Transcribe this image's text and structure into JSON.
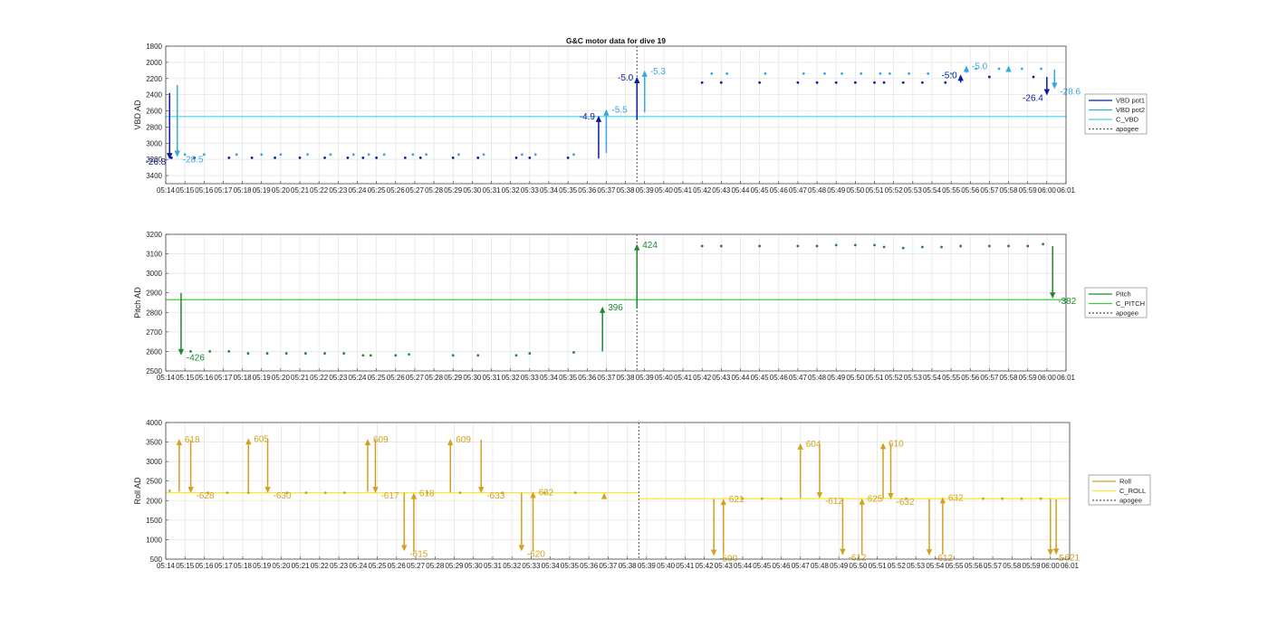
{
  "chart_data": [
    {
      "type": "scatter",
      "title": "G&C motor data for dive 19",
      "ylabel": "VBD AD",
      "ylim": [
        1800,
        3500
      ],
      "y_reversed": true,
      "yticks": [
        1800,
        2000,
        2200,
        2400,
        2600,
        2800,
        3000,
        3200,
        3400
      ],
      "xlim": [
        "05:14",
        "06:01"
      ],
      "apogee_x": "05:38.6",
      "grid": true,
      "legend_position": "outside-right",
      "legend": [
        "VBD pot1",
        "VBD pot2",
        "C_VBD",
        "apogee"
      ],
      "colors": {
        "pot1": "#0a1aa0",
        "pot2": "#3aa6e0",
        "c_line": "#3fd6e6",
        "apogee": "#555555"
      },
      "c_line": [
        {
          "x0": "05:14",
          "x1": "06:01",
          "y": 2670
        }
      ],
      "series": [
        {
          "name": "VBD pot1",
          "x": [
            "05:14.3",
            "05:15.5",
            "05:17.3",
            "05:18.5",
            "05:19.7",
            "05:21",
            "05:22.3",
            "05:23.5",
            "05:24.3",
            "05:25",
            "05:26.5",
            "05:27.3",
            "05:29",
            "05:30.3",
            "05:32.3",
            "05:33",
            "05:35",
            "05:42",
            "05:43",
            "05:45",
            "05:47",
            "05:48",
            "05:49",
            "05:50",
            "05:51",
            "05:51.5",
            "05:52.5",
            "05:53.5",
            "05:54.7",
            "05:57",
            "05:59.3"
          ],
          "y": [
            3180,
            3180,
            3180,
            3180,
            3180,
            3180,
            3180,
            3180,
            3180,
            3180,
            3180,
            3180,
            3180,
            3180,
            3180,
            3180,
            3180,
            2250,
            2250,
            2250,
            2250,
            2250,
            2250,
            2250,
            2250,
            2250,
            2250,
            2250,
            2250,
            2180,
            2180
          ]
        },
        {
          "name": "VBD pot2",
          "x": [
            "05:15",
            "05:16",
            "05:17.7",
            "05:19",
            "05:20",
            "05:21.4",
            "05:22.6",
            "05:23.8",
            "05:24.6",
            "05:25.4",
            "05:26.9",
            "05:27.6",
            "05:29.3",
            "05:30.6",
            "05:32.6",
            "05:33.3",
            "05:35.3",
            "05:42.5",
            "05:43.3",
            "05:45.3",
            "05:47.3",
            "05:48.4",
            "05:49.3",
            "05:50.3",
            "05:51.3",
            "05:51.8",
            "05:52.8",
            "05:53.8",
            "05:55",
            "05:56.3",
            "05:57.5",
            "05:58.7",
            "05:59.7"
          ],
          "y": [
            3140,
            3140,
            3140,
            3140,
            3140,
            3140,
            3140,
            3140,
            3140,
            3140,
            3140,
            3140,
            3140,
            3140,
            3140,
            3140,
            3140,
            2140,
            2140,
            2140,
            2140,
            2140,
            2140,
            2140,
            2140,
            2140,
            2140,
            2140,
            2140,
            2080,
            2080,
            2080,
            2080
          ]
        }
      ],
      "arrows": [
        {
          "x": "05:14.2",
          "y0": 2380,
          "y1": 3200,
          "label": "-26.8",
          "color": "pot1"
        },
        {
          "x": "05:14.6",
          "y0": 2280,
          "y1": 3170,
          "label": "-28.5",
          "color": "pot2"
        },
        {
          "x": "05:36.6",
          "y0": 3190,
          "y1": 2660,
          "label": "-4.9",
          "color": "pot1"
        },
        {
          "x": "05:37",
          "y0": 3120,
          "y1": 2580,
          "label": "-5.5",
          "color": "pot2"
        },
        {
          "x": "05:38.6",
          "y0": 2710,
          "y1": 2180,
          "label": "-5.0",
          "color": "pot1"
        },
        {
          "x": "05:39",
          "y0": 2620,
          "y1": 2100,
          "label": "-5.3",
          "color": "pot2"
        },
        {
          "x": "05:55.5",
          "y0": 2250,
          "y1": 2150,
          "label": "-5.0",
          "color": "pot1"
        },
        {
          "x": "05:55.8",
          "y0": 2130,
          "y1": 2040,
          "label": "-5.0",
          "color": "pot2"
        },
        {
          "x": "05:58",
          "y0": 2080,
          "y1": 2040,
          "label": "",
          "color": "pot2"
        },
        {
          "x": "06:00",
          "y0": 2180,
          "y1": 2410,
          "label": "-26.4",
          "color": "pot1"
        },
        {
          "x": "06:00.4",
          "y0": 2090,
          "y1": 2330,
          "label": "-28.6",
          "color": "pot2"
        }
      ]
    },
    {
      "type": "scatter",
      "ylabel": "Pitch AD",
      "ylim": [
        2500,
        3200
      ],
      "yticks": [
        2500,
        2600,
        2700,
        2800,
        2900,
        3000,
        3100,
        3200
      ],
      "xlim": [
        "05:14",
        "06:01"
      ],
      "apogee_x": "05:38.6",
      "grid": true,
      "legend_position": "outside-right",
      "legend": [
        "Pitch",
        "C_PITCH",
        "apogee"
      ],
      "colors": {
        "main": "#1f8a2e",
        "c_line": "#3ecb3e",
        "apogee": "#555555"
      },
      "c_line": [
        {
          "x0": "05:14",
          "x1": "06:01",
          "y": 2865
        }
      ],
      "series": [
        {
          "name": "Pitch",
          "x": [
            "05:15.3",
            "05:16.3",
            "05:17.3",
            "05:18.3",
            "05:19.3",
            "05:20.3",
            "05:21.3",
            "05:22.3",
            "05:23.3",
            "05:24.3",
            "05:24.7",
            "05:26",
            "05:26.7",
            "05:29",
            "05:30.3",
            "05:32.3",
            "05:33",
            "05:35.3",
            "05:42",
            "05:43",
            "05:45",
            "05:47",
            "05:48",
            "05:49",
            "05:50",
            "05:51",
            "05:51.5",
            "05:52.5",
            "05:53.5",
            "05:54.5",
            "05:55.5",
            "05:57",
            "05:58",
            "05:59",
            "05:59.8"
          ],
          "y": [
            2600,
            2600,
            2600,
            2590,
            2590,
            2590,
            2590,
            2590,
            2590,
            2580,
            2580,
            2580,
            2585,
            2580,
            2580,
            2580,
            2590,
            2595,
            3140,
            3140,
            3140,
            3140,
            3140,
            3145,
            3145,
            3145,
            3135,
            3130,
            3135,
            3135,
            3140,
            3140,
            3140,
            3140,
            3150
          ]
        }
      ],
      "arrows": [
        {
          "x": "05:14.8",
          "y0": 2900,
          "y1": 2580,
          "label": "-426"
        },
        {
          "x": "05:36.8",
          "y0": 2600,
          "y1": 2830,
          "label": "396"
        },
        {
          "x": "05:38.6",
          "y0": 2820,
          "y1": 3150,
          "label": "424"
        },
        {
          "x": "06:00.3",
          "y0": 3140,
          "y1": 2870,
          "label": "-382"
        }
      ]
    },
    {
      "type": "scatter",
      "ylabel": "Roll AD",
      "ylim": [
        500,
        4000
      ],
      "yticks": [
        500,
        1000,
        1500,
        2000,
        2500,
        3000,
        3500,
        4000
      ],
      "xlim": [
        "05:14",
        "06:01"
      ],
      "apogee_x": "05:38.6",
      "grid": true,
      "legend_position": "outside-right",
      "legend": [
        "Roll",
        "C_ROLL",
        "apogee"
      ],
      "colors": {
        "main": "#d4a020",
        "c_line": "#f2ea3a",
        "apogee": "#555555"
      },
      "c_line": [
        {
          "x0": "05:14",
          "x1": "05:38.6",
          "y": 2200
        },
        {
          "x0": "05:38.6",
          "x1": "06:01",
          "y": 2050
        }
      ],
      "series": [
        {
          "name": "Roll",
          "x": [
            "05:14.2",
            "05:16.2",
            "05:17.2",
            "05:18.3",
            "05:20.3",
            "05:21.3",
            "05:22.3",
            "05:23.3",
            "05:27.6",
            "05:29.3",
            "05:31.5",
            "05:33.7",
            "05:35.3",
            "05:44",
            "05:45",
            "05:46",
            "05:52.5",
            "05:56.5",
            "05:57.5",
            "05:58.5",
            "05:59.5"
          ],
          "y": [
            2250,
            2200,
            2200,
            2200,
            2200,
            2200,
            2200,
            2200,
            2200,
            2200,
            2200,
            2200,
            2200,
            2050,
            2050,
            2050,
            2050,
            2050,
            2050,
            2050,
            2050
          ]
        }
      ],
      "arrows": [
        {
          "x": "05:14.7",
          "y0": 2230,
          "y1": 3580,
          "label": "618"
        },
        {
          "x": "05:15.3",
          "y0": 3550,
          "y1": 2190,
          "label": "-628"
        },
        {
          "x": "05:18.3",
          "y0": 2220,
          "y1": 3600,
          "label": "605"
        },
        {
          "x": "05:19.3",
          "y0": 3580,
          "y1": 2190,
          "label": "-630"
        },
        {
          "x": "05:24.5",
          "y0": 2230,
          "y1": 3580,
          "label": "609"
        },
        {
          "x": "05:24.9",
          "y0": 3560,
          "y1": 2190,
          "label": "-617"
        },
        {
          "x": "05:26.4",
          "y0": 2200,
          "y1": 700,
          "label": "-615"
        },
        {
          "x": "05:26.9",
          "y0": 690,
          "y1": 2200,
          "label": "618"
        },
        {
          "x": "05:28.8",
          "y0": 2210,
          "y1": 3580,
          "label": "609"
        },
        {
          "x": "05:30.4",
          "y0": 3560,
          "y1": 2190,
          "label": "-633"
        },
        {
          "x": "05:32.5",
          "y0": 2200,
          "y1": 700,
          "label": "-620"
        },
        {
          "x": "05:33.1",
          "y0": 700,
          "y1": 2230,
          "label": "632"
        },
        {
          "x": "05:36.8",
          "y0": 2050,
          "y1": 2200,
          "label": ""
        },
        {
          "x": "05:42.5",
          "y0": 2040,
          "y1": 580,
          "label": "-590"
        },
        {
          "x": "05:43",
          "y0": 620,
          "y1": 2050,
          "label": "621"
        },
        {
          "x": "05:47",
          "y0": 2060,
          "y1": 3470,
          "label": "604"
        },
        {
          "x": "05:48",
          "y0": 3450,
          "y1": 2050,
          "label": "-612"
        },
        {
          "x": "05:49.2",
          "y0": 2050,
          "y1": 600,
          "label": "-612"
        },
        {
          "x": "05:50.2",
          "y0": 620,
          "y1": 2060,
          "label": "625"
        },
        {
          "x": "05:51.3",
          "y0": 2050,
          "y1": 3480,
          "label": "610"
        },
        {
          "x": "05:51.7",
          "y0": 3450,
          "y1": 2030,
          "label": "-632"
        },
        {
          "x": "05:53.7",
          "y0": 2040,
          "y1": 590,
          "label": "-612"
        },
        {
          "x": "05:54.4",
          "y0": 620,
          "y1": 2090,
          "label": "632"
        },
        {
          "x": "06:00",
          "y0": 2050,
          "y1": 590,
          "label": "-5"
        },
        {
          "x": "06:00.3",
          "y0": 2030,
          "y1": 610,
          "label": "-621"
        }
      ]
    }
  ],
  "x_tick_labels": [
    "05:14",
    "05:15",
    "05:16",
    "05:17",
    "05:18",
    "05:19",
    "05:20",
    "05:21",
    "05:22",
    "05:23",
    "05:24",
    "05:25",
    "05:26",
    "05:27",
    "05:28",
    "05:29",
    "05:30",
    "05:31",
    "05:32",
    "05:33",
    "05:34",
    "05:35",
    "05:36",
    "05:37",
    "05:38",
    "05:39",
    "05:40",
    "05:41",
    "05:42",
    "05:43",
    "05:44",
    "05:45",
    "05:46",
    "05:47",
    "05:48",
    "05:49",
    "05:50",
    "05:51",
    "05:52",
    "05:53",
    "05:54",
    "05:55",
    "05:56",
    "05:57",
    "05:58",
    "05:59",
    "06:00",
    "06:01"
  ]
}
